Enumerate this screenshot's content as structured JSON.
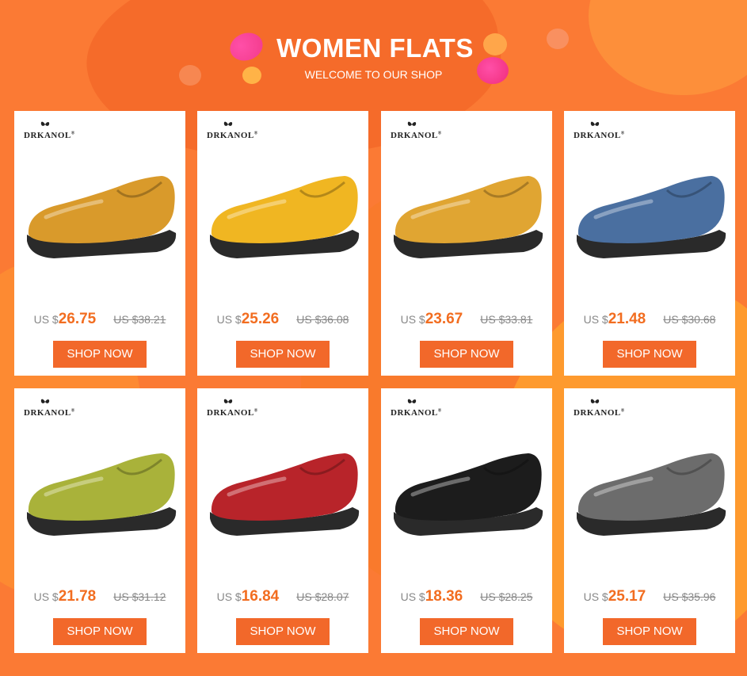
{
  "header": {
    "title": "WOMEN FLATS",
    "subtitle": "WELCOME TO OUR SHOP"
  },
  "products": [
    {
      "brand": "DRKANOL",
      "currency": "US $",
      "price": "26.75",
      "old_price": "US $38.21",
      "button": "SHOP NOW",
      "shoe_color": "#d99a2b",
      "icon": "cutout-mary-jane-shoe-icon"
    },
    {
      "brand": "DRKANOL",
      "currency": "US $",
      "price": "25.26",
      "old_price": "US $36.08",
      "button": "SHOP NOW",
      "shoe_color": "#f0b622",
      "icon": "yellow-loafer-icon"
    },
    {
      "brand": "DRKANOL",
      "currency": "US $",
      "price": "23.67",
      "old_price": "US $33.81",
      "button": "SHOP NOW",
      "shoe_color": "#e0a532",
      "icon": "strap-moccasin-icon"
    },
    {
      "brand": "DRKANOL",
      "currency": "US $",
      "price": "21.48",
      "old_price": "US $30.68",
      "button": "SHOP NOW",
      "shoe_color": "#4a6fa0",
      "icon": "patchwork-loafer-icon"
    },
    {
      "brand": "DRKANOL",
      "currency": "US $",
      "price": "21.78",
      "old_price": "US $31.12",
      "button": "SHOP NOW",
      "shoe_color": "#a9b23a",
      "icon": "flower-flat-icon"
    },
    {
      "brand": "DRKANOL",
      "currency": "US $",
      "price": "16.84",
      "old_price": "US $28.07",
      "button": "SHOP NOW",
      "shoe_color": "#b8242a",
      "icon": "red-lace-up-shoe-icon"
    },
    {
      "brand": "DRKANOL",
      "currency": "US $",
      "price": "18.36",
      "old_price": "US $28.25",
      "button": "SHOP NOW",
      "shoe_color": "#1c1c1c",
      "icon": "black-strap-shoe-icon"
    },
    {
      "brand": "DRKANOL",
      "currency": "US $",
      "price": "25.17",
      "old_price": "US $35.96",
      "button": "SHOP NOW",
      "shoe_color": "#6c6c6c",
      "icon": "silver-loafer-icon"
    }
  ]
}
